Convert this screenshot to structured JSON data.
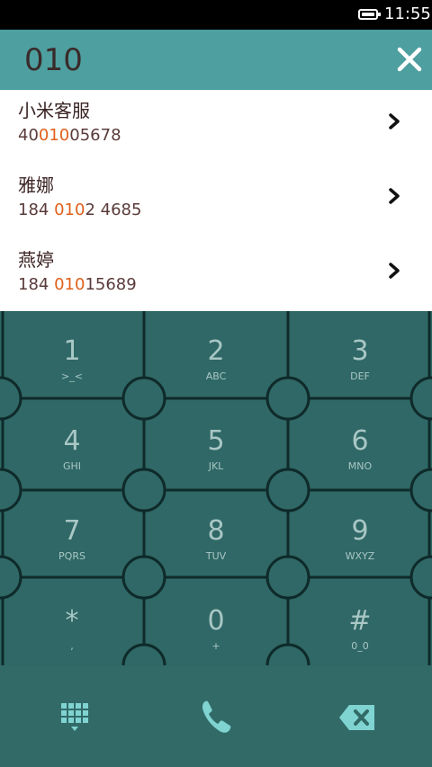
{
  "status_bar": {
    "time": "11:55"
  },
  "header": {
    "query": "010"
  },
  "results": [
    {
      "name": "小米客服",
      "number_parts": [
        "40",
        "010",
        "05678"
      ]
    },
    {
      "name": "雅娜",
      "number_parts": [
        "184 ",
        "010",
        "2 4685"
      ]
    },
    {
      "name": "燕婷",
      "number_parts": [
        "184 ",
        "010",
        "15689"
      ]
    }
  ],
  "keypad": {
    "keys": [
      {
        "digit": "1",
        "letters": ">_<"
      },
      {
        "digit": "2",
        "letters": "ABC"
      },
      {
        "digit": "3",
        "letters": "DEF"
      },
      {
        "digit": "4",
        "letters": "GHI"
      },
      {
        "digit": "5",
        "letters": "JKL"
      },
      {
        "digit": "6",
        "letters": "MNO"
      },
      {
        "digit": "7",
        "letters": "PQRS"
      },
      {
        "digit": "8",
        "letters": "TUV"
      },
      {
        "digit": "9",
        "letters": "WXYZ"
      },
      {
        "digit": "*",
        "letters": ","
      },
      {
        "digit": "0",
        "letters": "+"
      },
      {
        "digit": "#",
        "letters": "0_0"
      }
    ]
  },
  "colors": {
    "header": "#4e9f9f",
    "keypad": "#2f6866",
    "highlight": "#e0601a",
    "accent_icon": "#7fd3d0"
  },
  "icons": {
    "close": "close-icon",
    "chevron": "chevron-right-icon",
    "dialpad_toggle": "dialpad-icon",
    "call": "phone-icon",
    "backspace": "backspace-icon"
  }
}
